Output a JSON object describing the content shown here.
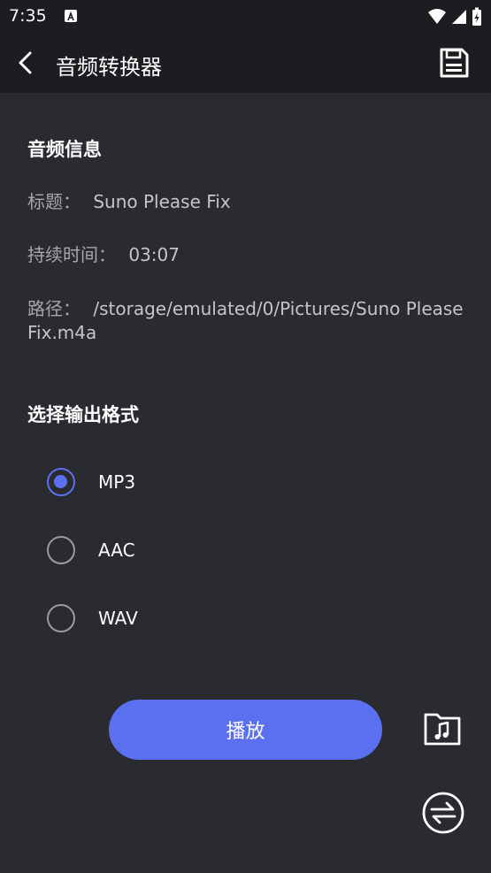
{
  "status_bar": {
    "time": "7:35"
  },
  "app_bar": {
    "title": "音频转换器"
  },
  "audio_info": {
    "section_title": "音频信息",
    "title_label": "标题：",
    "title_value": "Suno Please Fix",
    "duration_label": "持续时间：",
    "duration_value": "03:07",
    "path_label": "路径：",
    "path_value": "/storage/emulated/0/Pictures/Suno Please Fix.m4a"
  },
  "output_format": {
    "section_title": "选择输出格式",
    "options": [
      {
        "label": "MP3",
        "checked": true
      },
      {
        "label": "AAC",
        "checked": false
      },
      {
        "label": "WAV",
        "checked": false
      }
    ]
  },
  "actions": {
    "play_label": "播放"
  },
  "colors": {
    "accent": "#5b70f0",
    "background": "#2a2a31",
    "bar": "#1c1c21"
  }
}
